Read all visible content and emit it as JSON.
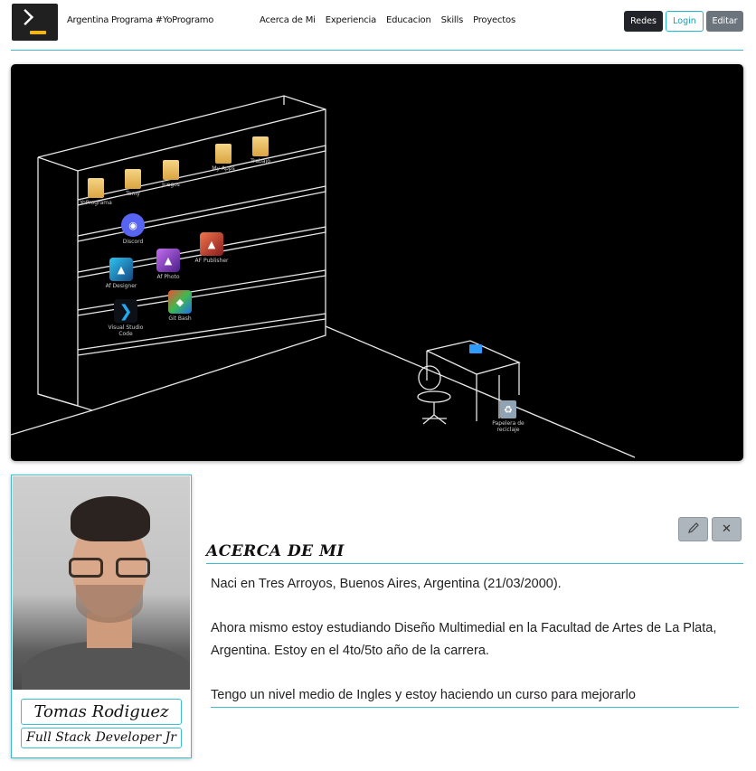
{
  "navbar": {
    "brand": "Argentina Programa #YoProgramo",
    "links": [
      "Acerca de Mi",
      "Experiencia",
      "Educacion",
      "Skills",
      "Proyectos"
    ],
    "buttons": {
      "redes": "Redes",
      "login": "Login",
      "editar": "Editar"
    }
  },
  "banner": {
    "icons": [
      {
        "label": "YoPrograma",
        "icon": "folder-icon"
      },
      {
        "label": "Tomy",
        "icon": "folder-icon"
      },
      {
        "label": "Juegos",
        "icon": "folder-icon"
      },
      {
        "label": "My Apps",
        "icon": "folder-icon"
      },
      {
        "label": "Trabajo",
        "icon": "folder-icon"
      },
      {
        "label": "Discord",
        "icon": "discord-icon"
      },
      {
        "label": "Af Designer",
        "icon": "affinity-designer-icon"
      },
      {
        "label": "Af Photo",
        "icon": "affinity-photo-icon"
      },
      {
        "label": "AF Publisher",
        "icon": "affinity-publisher-icon"
      },
      {
        "label": "Visual Studio Code",
        "icon": "vscode-icon"
      },
      {
        "label": "Git Bash",
        "icon": "git-icon"
      },
      {
        "label": "Papelera de reciclaje",
        "icon": "recycle-bin-icon"
      }
    ]
  },
  "profile": {
    "name": "Tomas Rodiguez",
    "role": "Full Stack Developer Jr"
  },
  "about": {
    "title": "ACERCA DE MI",
    "paragraphs": [
      "Naci en Tres Arroyos, Buenos Aires, Argentina (21/03/2000).",
      "Ahora mismo estoy estudiando Diseño Multimedial en la Facultad de Artes de La Plata, Argentina. Estoy en el 4to/5to año de la carrera.",
      "Tengo un nivel medio de Ingles y estoy haciendo un curso para mejorarlo"
    ],
    "edit_icon": "pencil-icon",
    "close_icon": "close-icon",
    "close_glyph": "✕"
  }
}
